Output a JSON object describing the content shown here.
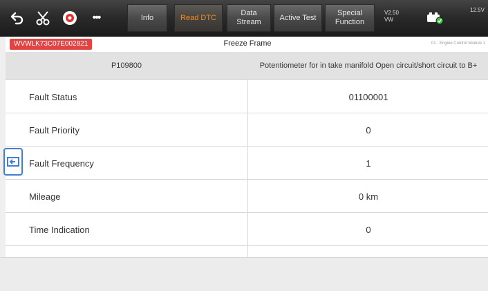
{
  "toolbar": {
    "icons": [
      "back-icon",
      "scissors-icon",
      "record-icon",
      "more-icon",
      "car-battery-icon"
    ],
    "more_label": "•••",
    "tabs": [
      {
        "label": "Info",
        "active": false
      },
      {
        "label": "Read DTC",
        "active": true
      },
      {
        "label": "Data\nStream",
        "active": false
      },
      {
        "label": "Active Test",
        "active": false
      },
      {
        "label": "Special\nFunction",
        "active": false
      }
    ],
    "version": "V2.50",
    "make": "VW",
    "status_right": "12.5V"
  },
  "titlebar": {
    "vin": "WVWLK73C07E002821",
    "title": "Freeze Frame",
    "module": "01 - Engine Control Module 1"
  },
  "table": {
    "header": {
      "code": "P109800",
      "description": "Potentiometer for in take manifold Open circuit/short circuit to B+"
    },
    "rows": [
      {
        "label": "Fault Status",
        "value": "01100001"
      },
      {
        "label": "Fault Priority",
        "value": "0"
      },
      {
        "label": "Fault Frequency",
        "value": "1"
      },
      {
        "label": "Mileage",
        "value": "0 km"
      },
      {
        "label": "Time Indication",
        "value": "0"
      },
      {
        "label": "",
        "value": ""
      }
    ]
  },
  "colors": {
    "accent_active_tab": "#f08a2a",
    "vin_badge": "#e24444",
    "side_button": "#3f7fd1"
  }
}
